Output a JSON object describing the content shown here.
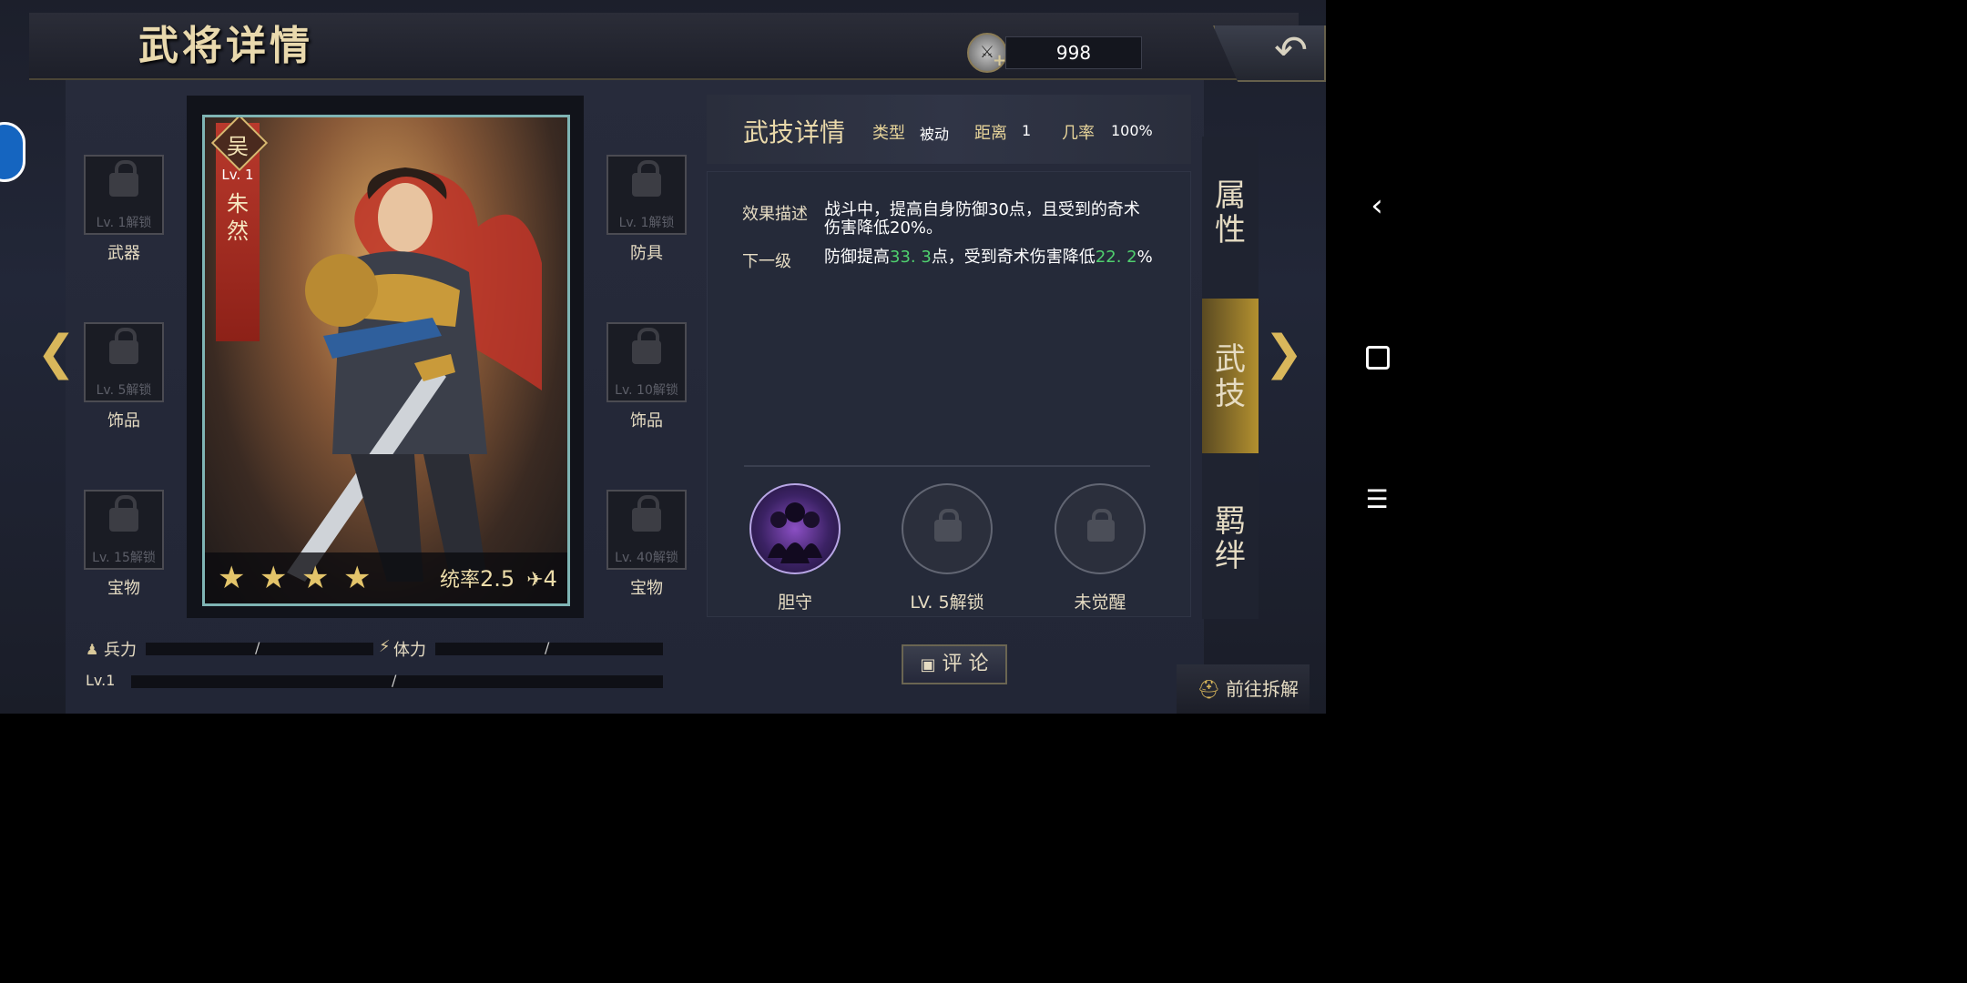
{
  "header": {
    "title": "武将详情",
    "resource_value": "998",
    "resource_icon": "halberd-coin-icon"
  },
  "hero": {
    "faction": "吴",
    "level": "Lv. 1",
    "name": "朱然",
    "stars": 4,
    "stat_label": "统率",
    "stat_value": "2.5",
    "move_value": "4"
  },
  "equip_left": [
    {
      "unlock": "Lv. 1解锁",
      "label": "武器"
    },
    {
      "unlock": "Lv. 5解锁",
      "label": "饰品"
    },
    {
      "unlock": "Lv. 15解锁",
      "label": "宝物"
    }
  ],
  "equip_right": [
    {
      "unlock": "Lv. 1解锁",
      "label": "防具"
    },
    {
      "unlock": "Lv. 10解锁",
      "label": "饰品"
    },
    {
      "unlock": "Lv. 40解锁",
      "label": "宝物"
    }
  ],
  "skill": {
    "title": "武技详情",
    "type_label": "类型",
    "type_value": "被动",
    "range_label": "距离",
    "range_value": "1",
    "rate_label": "几率",
    "rate_value": "100%",
    "desc_label": "效果描述",
    "desc_line1": "战斗中，提高自身防御30点，且受到的奇术",
    "desc_line2": "伤害降低20%。",
    "next_label": "下一级",
    "next_part1": "防御提高",
    "next_val1": "33. 3",
    "next_part2": "点，受到奇术伤害降低",
    "next_val2": "22. 2",
    "next_part3": "%"
  },
  "skills": [
    {
      "label": "胆守"
    },
    {
      "label": "LV. 5解锁"
    },
    {
      "label": "未觉醒"
    }
  ],
  "tabs": [
    {
      "line1": "属",
      "line2": "性"
    },
    {
      "line1": "武",
      "line2": "技"
    },
    {
      "line1": "羁",
      "line2": "绊"
    }
  ],
  "bars": {
    "troops_label": "兵力",
    "stamina_label": "体力",
    "level_label": "Lv.1"
  },
  "buttons": {
    "comment": "评 论",
    "goto": "前往拆解"
  },
  "colors": {
    "accent_gold": "#d9b75b",
    "green_value": "#4fcf6e",
    "banner_red": "#b9392c"
  }
}
